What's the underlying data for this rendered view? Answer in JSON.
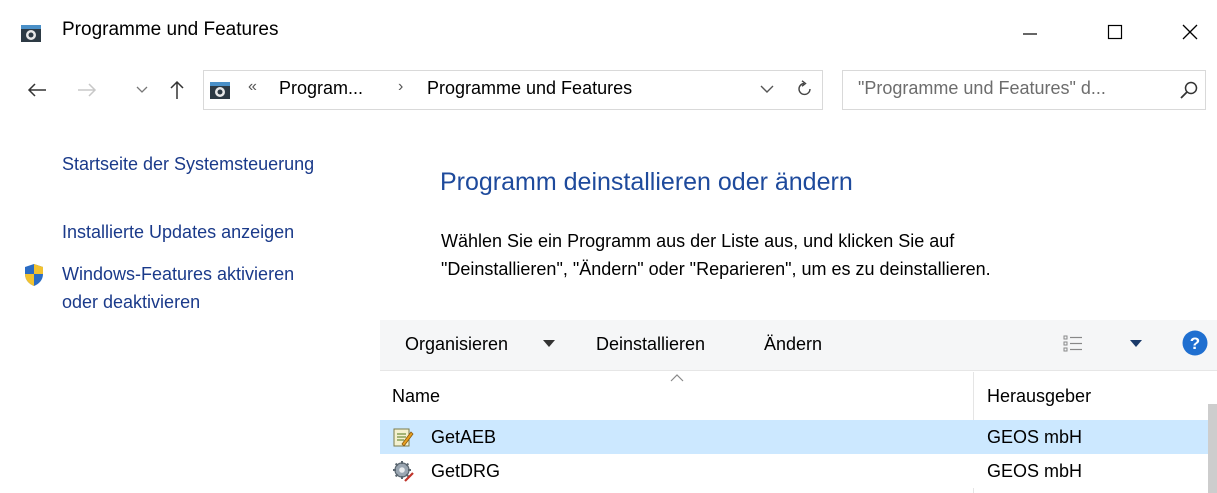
{
  "window": {
    "title": "Programme und Features"
  },
  "address_bar": {
    "overflow_chevron": "«",
    "breadcrumbs": [
      "Program...",
      "Programme und Features"
    ],
    "separator": "›",
    "search_placeholder": "\"Programme und Features\" d..."
  },
  "left_pane": {
    "home_link": "Startseite der Systemsteuerung",
    "updates_link": "Installierte Updates anzeigen",
    "features_link_line1": "Windows-Features aktivieren",
    "features_link_line2": "oder deaktivieren"
  },
  "main": {
    "heading": "Programm deinstallieren oder ändern",
    "description_line1": "Wählen Sie ein Programm aus der Liste aus, und klicken Sie auf",
    "description_line2": "\"Deinstallieren\", \"Ändern\" oder \"Reparieren\", um es zu deinstallieren."
  },
  "toolbar": {
    "organize": "Organisieren",
    "uninstall": "Deinstallieren",
    "change": "Ändern"
  },
  "list": {
    "columns": [
      "Name",
      "Herausgeber"
    ],
    "rows": [
      {
        "name": "GetAEB",
        "publisher": "GEOS mbH",
        "selected": true,
        "icon": "installer-icon"
      },
      {
        "name": "GetDRG",
        "publisher": "GEOS mbH",
        "selected": false,
        "icon": "gear-installer-icon"
      }
    ]
  },
  "colors": {
    "link": "#1a3a8a",
    "heading": "#1e4a9c",
    "selected_row": "#cce8ff",
    "toolbar_bg": "#f5f6f7",
    "help_blue": "#1f6fd0"
  }
}
